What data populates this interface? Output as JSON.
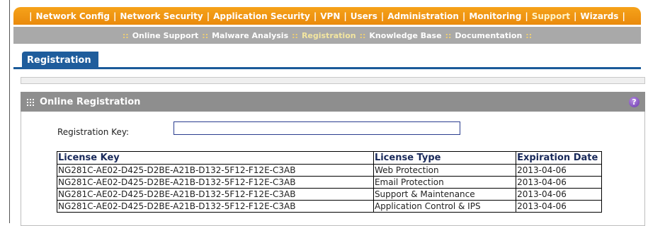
{
  "top_nav": [
    {
      "label": "Network Config",
      "current": false
    },
    {
      "label": "Network Security",
      "current": false
    },
    {
      "label": "Application Security",
      "current": false
    },
    {
      "label": "VPN",
      "current": false
    },
    {
      "label": "Users",
      "current": false
    },
    {
      "label": "Administration",
      "current": false
    },
    {
      "label": "Monitoring",
      "current": false
    },
    {
      "label": "Support",
      "current": true
    },
    {
      "label": "Wizards",
      "current": false
    }
  ],
  "sub_nav": [
    {
      "label": "Online Support",
      "current": false
    },
    {
      "label": "Malware Analysis",
      "current": false
    },
    {
      "label": "Registration",
      "current": true
    },
    {
      "label": "Knowledge Base",
      "current": false
    },
    {
      "label": "Documentation",
      "current": false
    }
  ],
  "tab": {
    "label": "Registration"
  },
  "section": {
    "title": "Online Registration",
    "help_label": "?"
  },
  "form": {
    "registration_key_label": "Registration Key:",
    "registration_key_value": ""
  },
  "table": {
    "headers": [
      "License Key",
      "License Type",
      "Expiration Date"
    ],
    "rows": [
      [
        "NG281C-AE02-D425-D2BE-A21B-D132-5F12-F12E-C3AB",
        "Web Protection",
        "2013-04-06"
      ],
      [
        "NG281C-AE02-D425-D2BE-A21B-D132-5F12-F12E-C3AB",
        "Email Protection",
        "2013-04-06"
      ],
      [
        "NG281C-AE02-D425-D2BE-A21B-D132-5F12-F12E-C3AB",
        "Support & Maintenance",
        "2013-04-06"
      ],
      [
        "NG281C-AE02-D425-D2BE-A21B-D132-5F12-F12E-C3AB",
        "Application Control & IPS",
        "2013-04-06"
      ]
    ]
  },
  "colors": {
    "top_nav": "#ee920f",
    "sub_nav": "#a9a9a9",
    "tab": "#1f5d9c",
    "section_header": "#8e8e8e"
  }
}
